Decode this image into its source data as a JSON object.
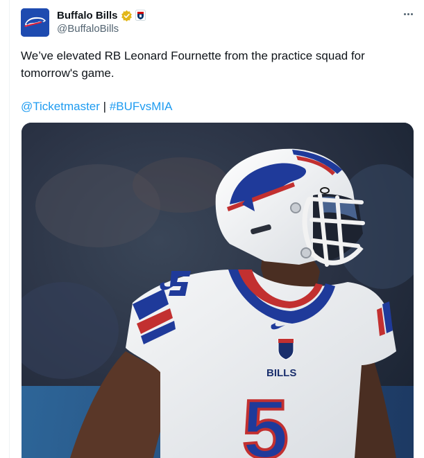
{
  "author": {
    "display_name": "Buffalo Bills",
    "handle": "@BuffaloBills",
    "verified_badge_icon": "gold-verified-badge",
    "affiliate_badge_icon": "nfl-shield-badge"
  },
  "more_icon": "more-horizontal-icon",
  "tweet": {
    "text": "We’ve elevated RB Leonard Fournette from the practice squad for tomorrow's game.",
    "mention": "@Ticketmaster",
    "separator": "|",
    "hashtag": "#BUFvsMIA"
  },
  "media": {
    "jersey_wordmark": "BILLS",
    "jersey_number": "5"
  },
  "colors": {
    "link": "#1d9bf0",
    "text_primary": "#0f1419",
    "text_secondary": "#536471",
    "bills_blue": "#00338d",
    "bills_red": "#c60c30"
  }
}
